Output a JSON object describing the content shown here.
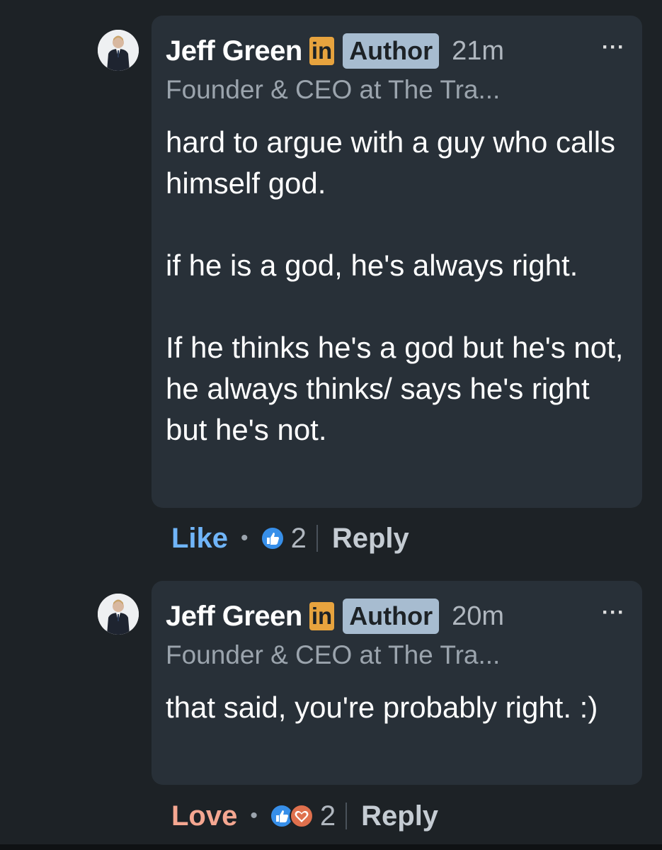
{
  "comments": [
    {
      "author": "Jeff Green",
      "network_badge": "in",
      "role_badge": "Author",
      "time": "21m",
      "more": "···",
      "headline": "Founder & CEO at The Tra...",
      "text": "hard to argue with a guy who calls himself god.\n\nif he is a god, he's always right.\n\nIf he thinks he's a god but he's not, he always thinks/ says he's right but he's not.",
      "reaction_label": "Like",
      "reaction_color": "#70b5f9",
      "reaction_icons": [
        "like-icon"
      ],
      "reaction_count": "2",
      "reply_label": "Reply"
    },
    {
      "author": "Jeff Green",
      "network_badge": "in",
      "role_badge": "Author",
      "time": "20m",
      "more": "···",
      "headline": "Founder & CEO at The Tra...",
      "text": "that said, you're probably right. :)",
      "reaction_label": "Love",
      "reaction_color": "#f5a791",
      "reaction_icons": [
        "like-icon",
        "love-icon"
      ],
      "reaction_count": "2",
      "reply_label": "Reply"
    }
  ],
  "colors": {
    "background": "#1d2226",
    "bubble": "#283038",
    "linkedin_badge": "#e7a33e",
    "author_badge": "#a7bcd0"
  }
}
